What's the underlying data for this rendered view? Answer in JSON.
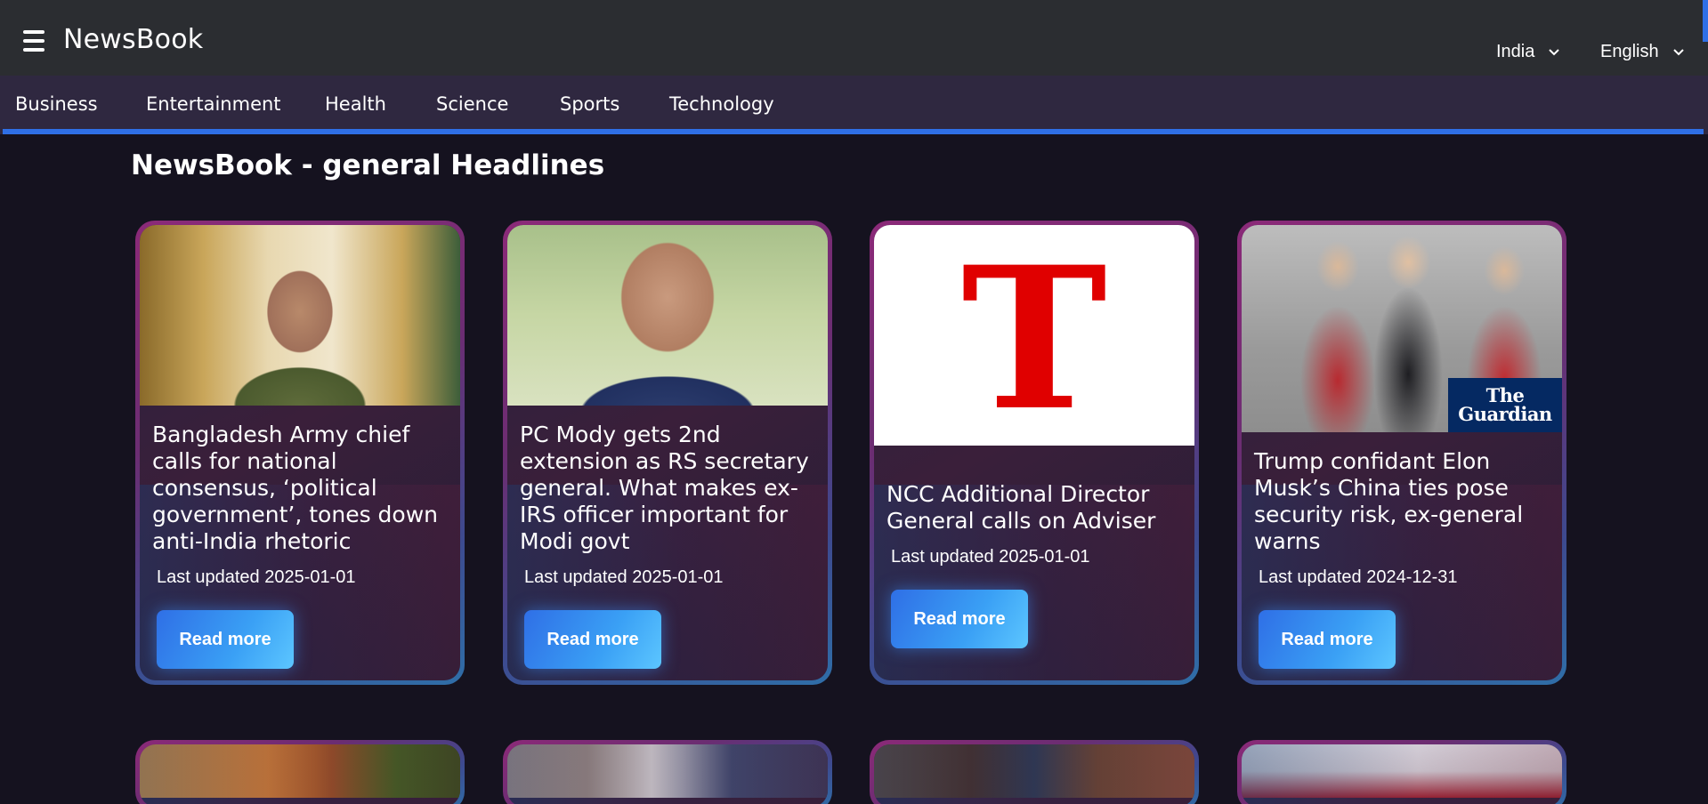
{
  "header": {
    "brand": "NewsBook",
    "country": "India",
    "language": "English"
  },
  "categories": [
    "Business",
    "Entertainment",
    "Health",
    "Science",
    "Sports",
    "Technology"
  ],
  "page_title": "NewsBook - general Headlines",
  "cards": [
    {
      "title": "Bangladesh Army chief calls for national consensus, ‘political government’, tones down anti-India rhetoric",
      "updated": "Last updated 2025-01-01",
      "button": "Read more"
    },
    {
      "title": "PC Mody gets 2nd extension as RS secretary general. What makes ex-IRS officer important for Modi govt",
      "updated": "Last updated 2025-01-01",
      "button": "Read more"
    },
    {
      "title": "NCC Additional Director General calls on Adviser",
      "updated": "Last updated 2025-01-01",
      "button": "Read more",
      "logo_text": "T"
    },
    {
      "title": "Trump confidant Elon Musk’s China ties pose security risk, ex-general warns",
      "updated": "Last updated 2024-12-31",
      "button": "Read more",
      "watermark": "The Guardian"
    }
  ],
  "colors": {
    "accent": "#2f6fe6",
    "background": "#15121f",
    "topbar": "#2b2d31",
    "category_bar": "#2f2840",
    "logo_red": "#e00000"
  }
}
